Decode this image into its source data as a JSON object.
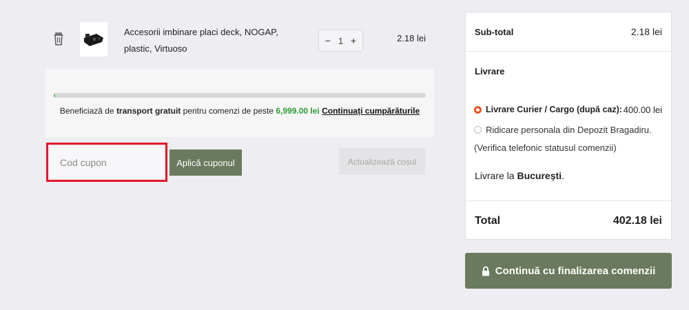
{
  "cart_item": {
    "name": "Accesorii imbinare placi deck, NOGAP, plastic, Virtuoso",
    "quantity": "1",
    "minus": "−",
    "plus": "+",
    "price": "2.18 lei"
  },
  "free_shipping": {
    "progress_fraction": 0.003,
    "text_prefix": "Beneficiază de ",
    "text_bold": "transport gratuit",
    "text_middle": " pentru comenzi de peste ",
    "threshold": "6,999.00 lei",
    "continue_link": "Continuați cumpărăturile"
  },
  "coupon": {
    "placeholder": "Cod cupon",
    "apply_label": "Aplică cuponul",
    "update_label": "Actualizează coșul"
  },
  "summary": {
    "subtotal_label": "Sub-total",
    "subtotal_value": "2.18 lei",
    "shipping_title": "Livrare",
    "option1_label": "Livrare Curier / Cargo (după caz):",
    "option1_price": "400.00 lei",
    "option2_label": "Ridicare personala din Depozit Bragadiru.",
    "verify_note": "(Verifica telefonic statusul comenzii)",
    "destination_prefix": "Livrare la ",
    "destination_city": "București",
    "destination_suffix": ".",
    "total_label": "Total",
    "total_value": "402.18 lei"
  },
  "checkout_label": "Continuă cu finalizarea comenzii",
  "colors": {
    "accent_green": "#6b7a5e",
    "progress_green": "#5fbf6a",
    "highlight_red": "#e0192a",
    "radio_orange": "#e8561f"
  }
}
